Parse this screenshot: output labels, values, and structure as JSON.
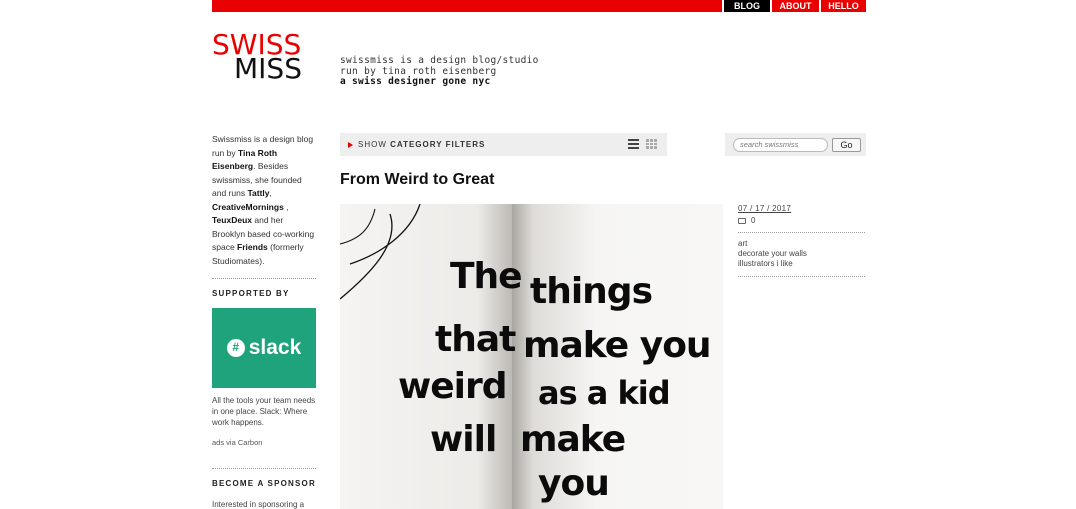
{
  "nav": {
    "blog": "BLOG",
    "about": "ABOUT",
    "hello": "HELLO"
  },
  "logo": {
    "line1": "SWISS",
    "line2": "MISS"
  },
  "tagline": {
    "line1": "swissmiss is a design blog/studio",
    "line2": "run by tina roth eisenberg",
    "line3": "a swiss designer gone nyc"
  },
  "sidebar": {
    "intro_1": "Swissmiss is a design blog run by ",
    "intro_name": "Tina Roth Eisenberg",
    "intro_2": ". Besides swissmiss, she founded and runs ",
    "tattly": "Tattly",
    "intro_3": ", ",
    "creativemornings": "CreativeMornings",
    "intro_4": " , ",
    "teuxdeux": "TeuxDeux",
    "intro_5": " and her Brooklyn based co-working space ",
    "friends": "Friends",
    "intro_6": " (formerly Studiomates).",
    "supported_heading": "SUPPORTED BY",
    "ad_brand": "slack",
    "ad_text": "All the tools your team needs in one place. Slack: Where work happens.",
    "ad_via": "ads via Carbon",
    "sponsor_heading": "BECOME A SPONSOR",
    "sponsor_text": "Interested in sponsoring a"
  },
  "filter": {
    "show": "SHOW ",
    "category": "CATEGORY FILTERS"
  },
  "search": {
    "placeholder": "search swissmiss",
    "go": "Go"
  },
  "post": {
    "title": "From Weird to Great",
    "image_text": {
      "left1": "The",
      "left2": "that",
      "left3": "weird",
      "left4": "will",
      "right1": "things",
      "right2": "make you",
      "right3": "as a kid",
      "right4": "make",
      "right5": "you"
    },
    "date": "07 / 17 / 2017",
    "comment_count": "0",
    "tags": [
      "art",
      "decorate your walls",
      "illustrators i like"
    ]
  }
}
